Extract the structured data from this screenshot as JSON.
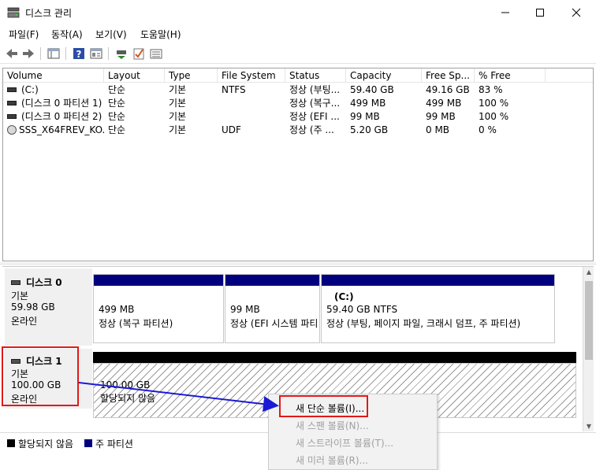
{
  "window": {
    "title": "디스크 관리"
  },
  "menu": [
    "파일(F)",
    "동작(A)",
    "보기(V)",
    "도움말(H)"
  ],
  "columns": [
    "Volume",
    "Layout",
    "Type",
    "File System",
    "Status",
    "Capacity",
    "Free Sp...",
    "% Free"
  ],
  "volumes": [
    {
      "volume": "(C:)",
      "layout": "단순",
      "type": "기본",
      "fs": "NTFS",
      "status": "정상 (부팅...",
      "capacity": "59.40 GB",
      "free": "49.16 GB",
      "pct": "83 %",
      "icon": "drive"
    },
    {
      "volume": "(디스크 0 파티션 1)",
      "layout": "단순",
      "type": "기본",
      "fs": "",
      "status": "정상 (복구...",
      "capacity": "499 MB",
      "free": "499 MB",
      "pct": "100 %",
      "icon": "drive"
    },
    {
      "volume": "(디스크 0 파티션 2)",
      "layout": "단순",
      "type": "기본",
      "fs": "",
      "status": "정상 (EFI ...",
      "capacity": "99 MB",
      "free": "99 MB",
      "pct": "100 %",
      "icon": "drive"
    },
    {
      "volume": "SSS_X64FREV_KO...",
      "layout": "단순",
      "type": "기본",
      "fs": "UDF",
      "status": "정상 (주 ...",
      "capacity": "5.20 GB",
      "free": "0 MB",
      "pct": "0 %",
      "icon": "cd"
    }
  ],
  "disk0": {
    "name": "디스크 0",
    "type": "기본",
    "size": "59.98 GB",
    "state": "온라인",
    "partitions": [
      {
        "title": "",
        "size": "499 MB",
        "status": "정상 (복구 파티션)"
      },
      {
        "title": "",
        "size": "99 MB",
        "status": "정상 (EFI 시스템 파티"
      },
      {
        "title": "(C:)",
        "size": "59.40 GB NTFS",
        "status": "정상 (부팅, 페이지 파일, 크래시 덤프, 주 파티션)"
      }
    ]
  },
  "disk1": {
    "name": "디스크 1",
    "type": "기본",
    "size": "100.00 GB",
    "state": "온라인",
    "unallocated": {
      "size": "100.00 GB",
      "label": "할당되지 않음"
    }
  },
  "legend": [
    {
      "label": "할당되지 않음",
      "color": "#000000"
    },
    {
      "label": "주 파티션",
      "color": "#00007f"
    }
  ],
  "context_menu": [
    {
      "label": "새 단순 볼륨(I)...",
      "enabled": true
    },
    {
      "label": "새 스팬 볼륨(N)...",
      "enabled": false
    },
    {
      "label": "새 스트라이프 볼륨(T)...",
      "enabled": false
    },
    {
      "label": "새 미러 볼륨(R)...",
      "enabled": false
    }
  ],
  "colors": {
    "primary_partition": "#00007f",
    "unallocated": "#000000",
    "highlight": "#e21919",
    "arrow": "#1a1ad6"
  }
}
